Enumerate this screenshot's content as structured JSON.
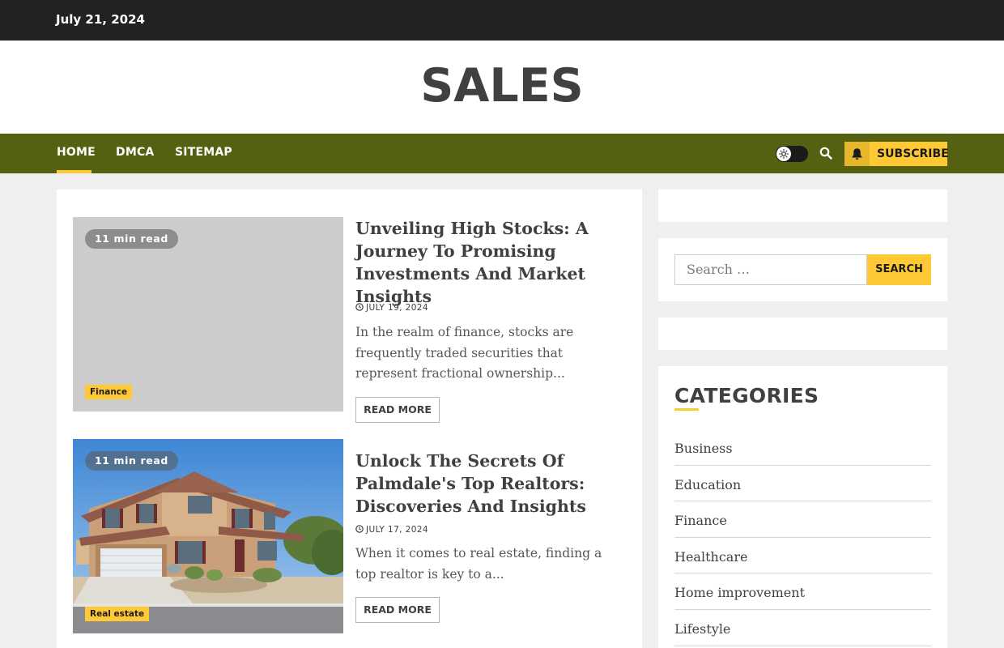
{
  "topbar": {
    "date": "July 21, 2024"
  },
  "header": {
    "site_title": "SALES"
  },
  "nav": {
    "items": [
      {
        "label": "HOME",
        "active": true
      },
      {
        "label": "DMCA"
      },
      {
        "label": "SITEMAP"
      }
    ],
    "subscribe_label": "SUBSCRIBE",
    "theme_toggle_icon": "sun-icon",
    "search_icon": "search-icon"
  },
  "posts": [
    {
      "read_time": "11 min read",
      "category": "Finance",
      "title": "Unveiling High Stocks: A Journey To Promising Investments And Market Insights",
      "date": "JULY 19, 2024",
      "excerpt": "In the realm of finance, stocks are frequently traded securities that represent fractional ownership...",
      "read_more": "READ MORE"
    },
    {
      "read_time": "11 min read",
      "category": "Real estate",
      "title": "Unlock The Secrets Of Palmdale's Top Realtors: Discoveries And Insights",
      "date": "JULY 17, 2024",
      "excerpt": "When it comes to real estate, finding a top realtor is key to a...",
      "read_more": "READ MORE"
    }
  ],
  "sidebar": {
    "search": {
      "placeholder": "Search …",
      "button_label": "SEARCH"
    },
    "categories": {
      "title": "CATEGORIES",
      "items": [
        "Business",
        "Education",
        "Finance",
        "Healthcare",
        "Home improvement",
        "Lifestyle"
      ]
    }
  },
  "colors": {
    "topbar": "#222222",
    "nav": "#556110",
    "accent": "#ffc935",
    "page_bg": "#efefef"
  }
}
